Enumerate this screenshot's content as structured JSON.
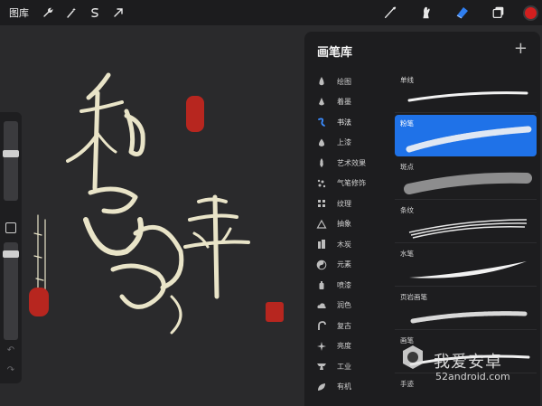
{
  "topbar": {
    "gallery_label": "图库",
    "left_icons": [
      "wrench-icon",
      "magic-wand-icon",
      "selection-icon",
      "transform-arrow-icon"
    ],
    "right_icons": [
      "brush-icon",
      "smudge-icon",
      "eraser-icon",
      "layers-icon"
    ],
    "color": "#d21f1f"
  },
  "panel": {
    "title": "画笔库",
    "add_label": "+",
    "sets": [
      {
        "label": "绘图",
        "icon": "drop-icon"
      },
      {
        "label": "着墨",
        "icon": "ink-drop-icon"
      },
      {
        "label": "书法",
        "icon": "calligraphy-icon",
        "active": true
      },
      {
        "label": "上漆",
        "icon": "paint-drop-icon"
      },
      {
        "label": "艺术效果",
        "icon": "flame-icon"
      },
      {
        "label": "气笔修饰",
        "icon": "airbrush-icon"
      },
      {
        "label": "纹理",
        "icon": "texture-icon"
      },
      {
        "label": "抽象",
        "icon": "triangle-icon"
      },
      {
        "label": "木炭",
        "icon": "charcoal-icon"
      },
      {
        "label": "元素",
        "icon": "yin-yang-icon"
      },
      {
        "label": "喷漆",
        "icon": "spray-can-icon"
      },
      {
        "label": "润色",
        "icon": "cloud-icon"
      },
      {
        "label": "复古",
        "icon": "retro-icon"
      },
      {
        "label": "亮度",
        "icon": "sparkle-icon"
      },
      {
        "label": "工业",
        "icon": "anvil-icon"
      },
      {
        "label": "有机",
        "icon": "leaf-icon"
      }
    ],
    "brushes": [
      {
        "label": "单线"
      },
      {
        "label": "粉笔",
        "active": true
      },
      {
        "label": "斑点"
      },
      {
        "label": "条纹"
      },
      {
        "label": "水笔"
      },
      {
        "label": "页岩画笔"
      },
      {
        "label": "画笔"
      },
      {
        "label": "手迹"
      }
    ]
  },
  "watermark": {
    "text": "我爱安卓",
    "url": "52android.com"
  }
}
